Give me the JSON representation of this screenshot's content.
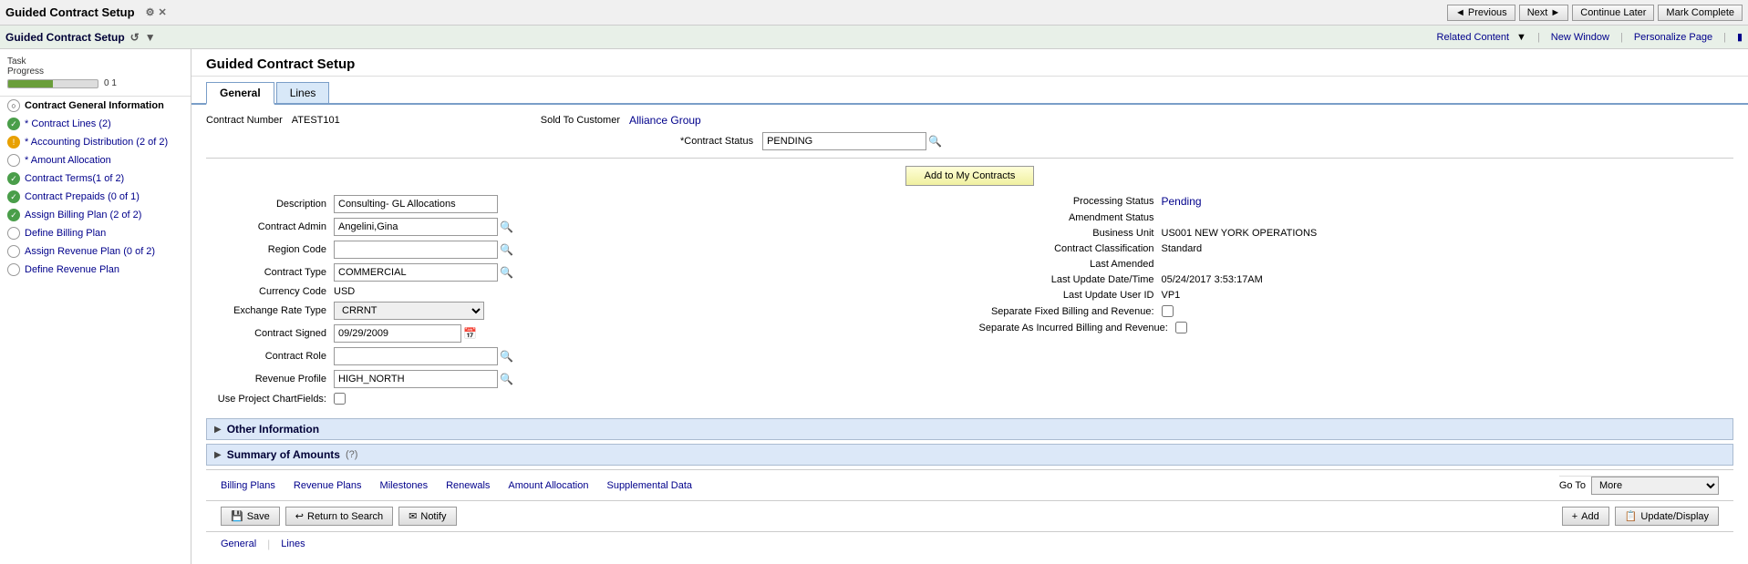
{
  "topBar": {
    "title": "Guided Contract Setup",
    "gearIcon": "⚙",
    "closeIcon": "✕"
  },
  "secondBar": {
    "title": "Guided Contract Setup",
    "refreshIcon": "↺",
    "settingsIcon": "▼",
    "relatedContent": "Related Content",
    "newWindow": "New Window",
    "personalizePage": "Personalize Page"
  },
  "topNav": {
    "previousLabel": "◄ Previous",
    "nextLabel": "Next ►",
    "continueLaterLabel": "Continue Later",
    "markCompleteLabel": "Mark Complete"
  },
  "taskProgress": {
    "label": "Task\nProgress",
    "min": "0",
    "max": "1",
    "fillPercent": 50
  },
  "sidebar": {
    "items": [
      {
        "id": "contract-general",
        "label": "Contract General Information",
        "iconType": "empty-circle",
        "active": true
      },
      {
        "id": "contract-lines",
        "label": "* Contract Lines (2)",
        "iconType": "green"
      },
      {
        "id": "accounting-dist",
        "label": "* Accounting Distribution (2 of 2)",
        "iconType": "yellow"
      },
      {
        "id": "amount-allocation",
        "label": "* Amount Allocation",
        "iconType": "empty-circle"
      },
      {
        "id": "contract-terms",
        "label": "Contract Terms(1 of 2)",
        "iconType": "green"
      },
      {
        "id": "contract-prepaids",
        "label": "Contract Prepaids (0 of 1)",
        "iconType": "green"
      },
      {
        "id": "assign-billing",
        "label": "Assign Billing Plan (2 of 2)",
        "iconType": "green"
      },
      {
        "id": "define-billing",
        "label": "Define Billing Plan",
        "iconType": "empty-circle"
      },
      {
        "id": "assign-revenue",
        "label": "Assign Revenue Plan (0 of 2)",
        "iconType": "empty-circle"
      },
      {
        "id": "define-revenue",
        "label": "Define Revenue Plan",
        "iconType": "empty-circle"
      }
    ]
  },
  "pageTitle": "Guided Contract Setup",
  "tabs": [
    {
      "id": "general",
      "label": "General",
      "active": true
    },
    {
      "id": "lines",
      "label": "Lines"
    }
  ],
  "contractInfo": {
    "contractNumberLabel": "Contract Number",
    "contractNumber": "ATEST101",
    "soldToCustomerLabel": "Sold To Customer",
    "soldToCustomer": "Alliance Group",
    "contractStatusLabel": "*Contract Status",
    "contractStatus": "PENDING",
    "addToMyContractsBtn": "Add to My Contracts"
  },
  "formLeft": {
    "descriptionLabel": "Description",
    "descriptionValue": "Consulting- GL Allocations",
    "contractAdminLabel": "Contract Admin",
    "contractAdminValue": "Angelini,Gina",
    "regionCodeLabel": "Region Code",
    "regionCodeValue": "",
    "contractTypeLabel": "Contract Type",
    "contractTypeValue": "COMMERCIAL",
    "currencyCodeLabel": "Currency Code",
    "currencyCodeValue": "USD",
    "exchangeRateTypeLabel": "Exchange Rate Type",
    "exchangeRateTypeValue": "CRRNT",
    "contractSignedLabel": "Contract Signed",
    "contractSignedValue": "09/29/2009",
    "contractRoleLabel": "Contract Role",
    "contractRoleValue": "",
    "revenueProfileLabel": "Revenue Profile",
    "revenueProfileValue": "HIGH_NORTH",
    "useProjectChartFieldsLabel": "Use Project ChartFields:"
  },
  "formRight": {
    "processingStatusLabel": "Processing Status",
    "processingStatusValue": "Pending",
    "amendmentStatusLabel": "Amendment Status",
    "amendmentStatusValue": "",
    "businessUnitLabel": "Business Unit",
    "businessUnitValue": "US001 NEW YORK OPERATIONS",
    "contractClassificationLabel": "Contract Classification",
    "contractClassificationValue": "Standard",
    "lastAmendedLabel": "Last Amended",
    "lastAmendedValue": "",
    "lastUpdateDateTimeLabel": "Last Update Date/Time",
    "lastUpdateDateTimeValue": "05/24/2017  3:53:17AM",
    "lastUpdateUserIdLabel": "Last Update User ID",
    "lastUpdateUserIdValue": "VP1",
    "separateFixedBillingLabel": "Separate Fixed Billing and Revenue:",
    "separateAsIncurredLabel": "Separate As Incurred Billing and Revenue:"
  },
  "sections": {
    "otherInformation": "Other Information",
    "summaryOfAmounts": "Summary of Amounts"
  },
  "bottomNav": {
    "billingPlans": "Billing Plans",
    "revenuePlans": "Revenue Plans",
    "milestones": "Milestones",
    "renewals": "Renewals",
    "amountAllocation": "Amount Allocation",
    "supplementalData": "Supplemental Data",
    "goToLabel": "Go To",
    "moreOption": "More"
  },
  "actions": {
    "saveLabel": "Save",
    "returnToSearchLabel": "Return to Search",
    "notifyLabel": "Notify",
    "addLabel": "Add",
    "updateDisplayLabel": "Update/Display"
  },
  "bottomLinks": {
    "general": "General",
    "lines": "Lines"
  }
}
